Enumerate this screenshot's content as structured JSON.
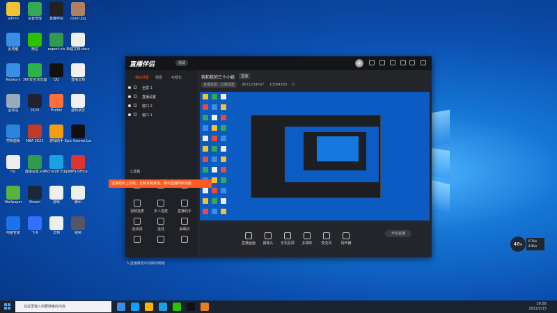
{
  "desktop": {
    "icons": [
      {
        "label": "admin",
        "color": "#f1c232"
      },
      {
        "label": "设置管理",
        "color": "#34a853"
      },
      {
        "label": "直播伴侣",
        "color": "#222"
      },
      {
        "label": "cover.jpg",
        "color": "#b08060"
      },
      {
        "label": "此电脑",
        "color": "#3a8ee6"
      },
      {
        "label": "微信",
        "color": "#2dc100"
      },
      {
        "label": "export.xls",
        "color": "#2e9b4f"
      },
      {
        "label": "新建文档.docx",
        "color": "#eee"
      },
      {
        "label": "Network",
        "color": "#3a8ee6"
      },
      {
        "label": "360安全浏览器",
        "color": "#2db34a"
      },
      {
        "label": "QQ",
        "color": "#111"
      },
      {
        "label": "直播文档",
        "color": "#f0f0f0"
      },
      {
        "label": "回收站",
        "color": "#9ab"
      },
      {
        "label": "2K20",
        "color": "#223"
      },
      {
        "label": "Firefox",
        "color": "#ff7139"
      },
      {
        "label": "游戏录屏",
        "color": "#f0f0f0"
      },
      {
        "label": "控制面板",
        "color": "#2a84d8"
      },
      {
        "label": "NBA 2K21",
        "color": "#c0392b"
      },
      {
        "label": "游戏助手",
        "color": "#f39c12"
      },
      {
        "label": "Epic Games Launcher",
        "color": "#111"
      },
      {
        "label": "mc",
        "color": "#eee"
      },
      {
        "label": "直播设置.xls",
        "color": "#2e9b4f"
      },
      {
        "label": "Microsoft Edge",
        "color": "#1ba1e2"
      },
      {
        "label": "WPS Office",
        "color": "#d33"
      },
      {
        "label": "Wallpaper",
        "color": "#5ab33c"
      },
      {
        "label": "Steam",
        "color": "#1b2838"
      },
      {
        "label": "游戏",
        "color": "#eee"
      },
      {
        "label": "腾讯",
        "color": "#eee"
      },
      {
        "label": "电脑管家",
        "color": "#1a73e8"
      },
      {
        "label": "飞书",
        "color": "#3370ff"
      },
      {
        "label": "文档",
        "color": "#eee"
      },
      {
        "label": "视频",
        "color": "#556"
      }
    ]
  },
  "app": {
    "title": "直播伴侣",
    "version": "测试",
    "left_tabs": [
      "我的场景",
      "场景",
      "可视化"
    ],
    "sources": [
      "全屏 1",
      "直播设置",
      "窗口 2",
      "窗口 1"
    ],
    "tools_title": "工具箱",
    "tools": [
      "",
      "",
      "",
      "视频连麦",
      "多人连麦",
      "直播助手",
      "连线调",
      "连线",
      "弹幕机",
      "",
      "",
      ""
    ],
    "tip": "连接助手上线啦，定制专属推流，推出直播间新功能",
    "notice": "5.直播推流中请保持网络",
    "main_title": "我和我的三十小姐",
    "main_tag": "直播",
    "stats": {
      "chip": "直播设置 · 云端设置",
      "id": "8671234567",
      "fans": "10584393",
      "likes": "0"
    },
    "bottom_buttons": [
      "直播画面",
      "摄像头",
      "手机投屏",
      "多媒体",
      "麦克风",
      "扬声器"
    ],
    "start_label": "开始直播"
  },
  "net": {
    "value": "46",
    "unit": "%",
    "up": "0.7k/s",
    "down": "2.5k/s"
  },
  "taskbar": {
    "search_placeholder": "在这里输入你要搜索的内容",
    "time": "20:58",
    "date": "2022/2/15",
    "icons": [
      "#3a8ee6",
      "#0aa3ff",
      "#ffb400",
      "#1ba1e2",
      "#2dc100",
      "#111",
      "#e67e22"
    ]
  }
}
